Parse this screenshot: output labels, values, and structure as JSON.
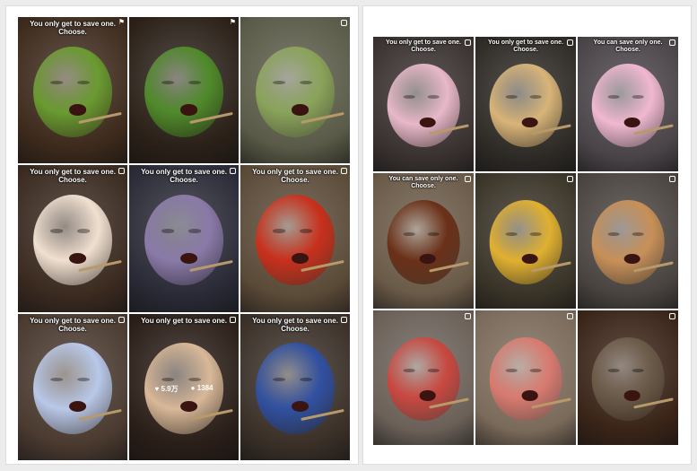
{
  "left_grid": {
    "tiles": [
      {
        "caption": "You only get to save one.\nChoose.",
        "icon": "pin-icon",
        "bg": "#3d2a1c",
        "face": "#6a9a30"
      },
      {
        "caption": "",
        "icon": "pin-icon",
        "bg": "#2a2018",
        "face": "#4f8a2a"
      },
      {
        "caption": "",
        "icon": "reel-icon",
        "bg": "#5a5a48",
        "face": "#8aa35a"
      },
      {
        "caption": "You only get to save one.\nChoose.",
        "icon": "reel-icon",
        "bg": "#3a2a20",
        "face": "#f0e0d0"
      },
      {
        "caption": "You only get to save one.\nChoose.",
        "icon": "reel-icon",
        "bg": "#2a2a36",
        "face": "#8a7aa8"
      },
      {
        "caption": "You only get to save one.\nChoose.",
        "icon": "reel-icon",
        "bg": "#5a4a38",
        "face": "#c8301c"
      },
      {
        "caption": "You only get to save one.\nChoose.",
        "icon": "reel-icon",
        "bg": "#4a3a30",
        "face": "#b8c8e8"
      },
      {
        "caption": "You only get to save one.",
        "icon": "reel-icon",
        "bg": "#2a1e18",
        "face": "#d8b898",
        "likes": "5.9万",
        "comments": "1384"
      },
      {
        "caption": "You only get to save one.\nChoose.",
        "icon": "reel-icon",
        "bg": "#3a3028",
        "face": "#3050a0"
      }
    ]
  },
  "right_grid": {
    "tiles": [
      {
        "caption": "You only get to save one.\nChoose.",
        "icon": "reel-icon",
        "bg": "#3a3230",
        "face": "#e8b8c8"
      },
      {
        "caption": "You only get to save one.\nChoose.",
        "icon": "reel-icon",
        "bg": "#2e2a26",
        "face": "#d8b478"
      },
      {
        "caption": "You can save only one.\nChoose.",
        "icon": "reel-icon",
        "bg": "#4a4448",
        "face": "#f0b8d0"
      },
      {
        "caption": "You can save only one.\nChoose.",
        "icon": "reel-icon",
        "bg": "#6a5a48",
        "face": "#6a3018"
      },
      {
        "caption": "",
        "icon": "reel-icon",
        "bg": "#3a3428",
        "face": "#e0b030"
      },
      {
        "caption": "",
        "icon": "reel-icon",
        "bg": "#4a4440",
        "face": "#c89058"
      },
      {
        "caption": "",
        "icon": "reel-icon",
        "bg": "#6a6058",
        "face": "#c84840"
      },
      {
        "caption": "",
        "icon": "reel-icon",
        "bg": "#7a6a5a",
        "face": "#d87a70"
      },
      {
        "caption": "",
        "icon": "reel-icon",
        "bg": "#3a2418",
        "face": "#6a5a48"
      }
    ]
  }
}
